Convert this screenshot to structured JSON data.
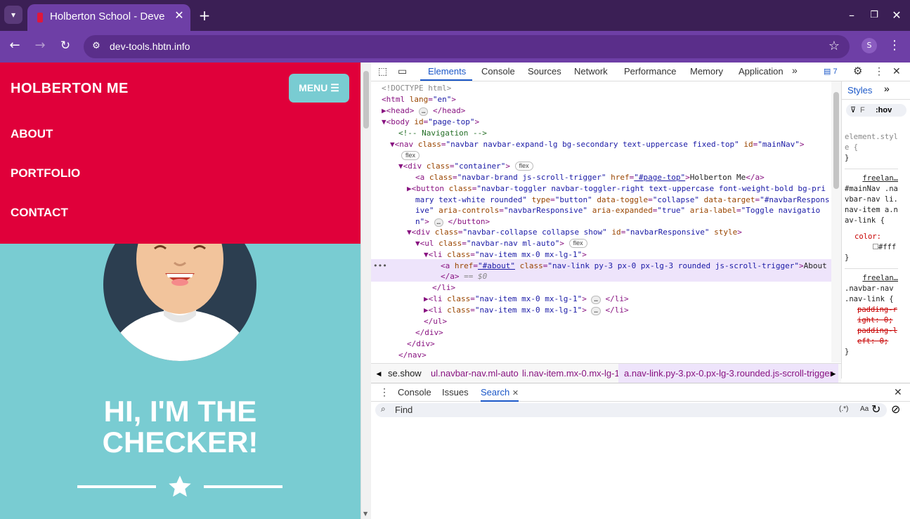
{
  "browser": {
    "tab_title": "Holberton School - Deve",
    "url": "dev-tools.hbtn.info",
    "profile_initial": "S"
  },
  "page": {
    "brand": "HOLBERTON ME",
    "menu_label": "MENU ☰",
    "nav_links": [
      "ABOUT",
      "PORTFOLIO",
      "CONTACT"
    ],
    "hero_title_line1": "HI, I'M THE",
    "hero_title_line2": "CHECKER!"
  },
  "devtools": {
    "tabs": [
      "Elements",
      "Console",
      "Sources",
      "Network",
      "Performance",
      "Memory",
      "Application"
    ],
    "active_tab": "Elements",
    "issues_count": "7",
    "styles_tab": "Styles",
    "filter_placeholder": "F",
    "hov_label": ":hov",
    "breadcrumbs": [
      "se.show",
      "ul.navbar-nav.ml-auto",
      "li.nav-item.mx-0.mx-lg-1",
      "a.nav-link.py-3.px-0.px-lg-3.rounded.js-scroll-trigger"
    ],
    "drawer_tabs": [
      "Console",
      "Issues",
      "Search"
    ],
    "search_placeholder": "Find",
    "search_regex": "(.*)",
    "search_case": "Aa",
    "styles_rules": {
      "element_style": "element.style {",
      "rule1_source": "freelan…",
      "rule1_selector": "#mainNav .navbar-nav li.nav-item a.nav-link {",
      "rule1_prop": "color:",
      "rule1_value": "#fff",
      "rule2_source": "freelan…",
      "rule2_selector": ".navbar-nav .nav-link {",
      "rule2_prop1": "padding-right: 0;",
      "rule2_prop2": "padding-left: 0;"
    }
  },
  "colors": {
    "tabbar": "#3b1f55",
    "toolbar": "#6e3fa6",
    "nav_red": "#e0003a",
    "teal": "#79ccd2",
    "dark_circle": "#2c3e50",
    "devtools_accent": "#1a57c8"
  }
}
